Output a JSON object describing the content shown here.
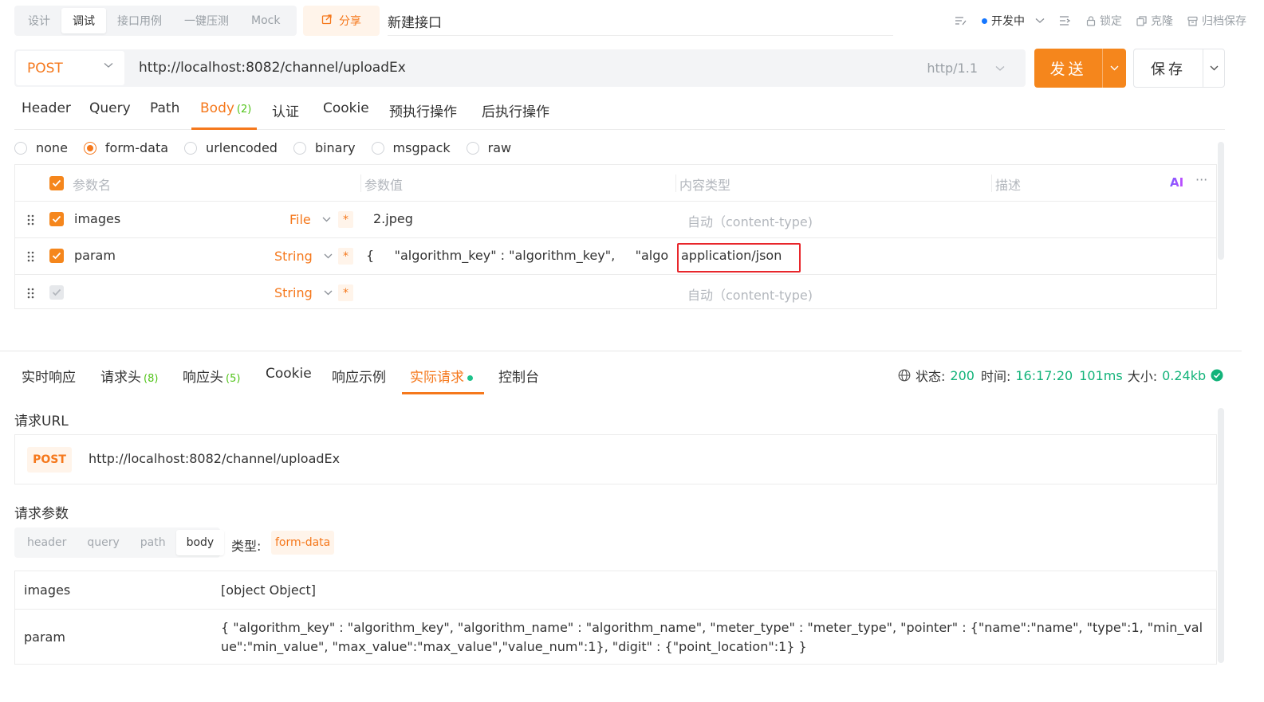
{
  "mode_tabs": [
    "设计",
    "调试",
    "接口用例",
    "一键压测",
    "Mock"
  ],
  "share_label": "分享",
  "api_title": "新建接口",
  "top_right": {
    "env": "开发中",
    "lock": "锁定",
    "clone": "克隆",
    "archive": "归档保存"
  },
  "request": {
    "method": "POST",
    "url": "http://localhost:8082/channel/uploadEx",
    "http_version": "http/1.1",
    "send_label": "发送",
    "save_label": "保存"
  },
  "req_tabs": {
    "header": "Header",
    "query": "Query",
    "path": "Path",
    "body": "Body",
    "body_count": "(2)",
    "auth": "认证",
    "cookie": "Cookie",
    "pre": "预执行操作",
    "post": "后执行操作"
  },
  "body_types": [
    "none",
    "form-data",
    "urlencoded",
    "binary",
    "msgpack",
    "raw"
  ],
  "params_table": {
    "headers": [
      "参数名",
      "参数值",
      "内容类型",
      "描述"
    ],
    "ai_label": "AI",
    "rows": [
      {
        "name": "images",
        "type": "File",
        "value": "2.jpeg",
        "content_type": "自动（content-type)",
        "required": "*"
      },
      {
        "name": "param",
        "type": "String",
        "value": "{     \"algorithm_key\" : \"algorithm_key\",     \"algorith",
        "content_type": "application/json",
        "required": "*"
      },
      {
        "name": "",
        "type": "String",
        "value": "",
        "content_type": "自动（content-type)",
        "required": "*"
      }
    ]
  },
  "response": {
    "tabs": {
      "realtime": "实时响应",
      "req_headers": "请求头",
      "req_headers_count": "(8)",
      "resp_headers": "响应头",
      "resp_headers_count": "(5)",
      "cookie": "Cookie",
      "example": "响应示例",
      "actual": "实际请求",
      "console": "控制台"
    },
    "status": {
      "status_label": "状态:",
      "status_value": "200",
      "time_label": "时间:",
      "time_value": "16:17:20",
      "duration": "101ms",
      "size_label": "大小:",
      "size_value": "0.24kb"
    }
  },
  "actual_request": {
    "url_label": "请求URL",
    "method": "POST",
    "url": "http://localhost:8082/channel/uploadEx",
    "params_label": "请求参数",
    "seg_tabs": [
      "header",
      "query",
      "path",
      "body"
    ],
    "type_label": "类型:",
    "type_value": "form-data",
    "rows": [
      {
        "key": "images",
        "value": "[object Object]"
      },
      {
        "key": "param",
        "value": "{ \"algorithm_key\" : \"algorithm_key\", \"algorithm_name\" : \"algorithm_name\", \"meter_type\" : \"meter_type\", \"pointer\" : {\"name\":\"name\", \"type\":1, \"min_value\":\"min_value\", \"max_value\":\"max_value\",\"value_num\":1}, \"digit\" : {\"point_location\":1} }"
      }
    ]
  },
  "colors": {
    "accent": "#f5781c",
    "success": "#13b37a",
    "highlight": "#e8262b"
  }
}
